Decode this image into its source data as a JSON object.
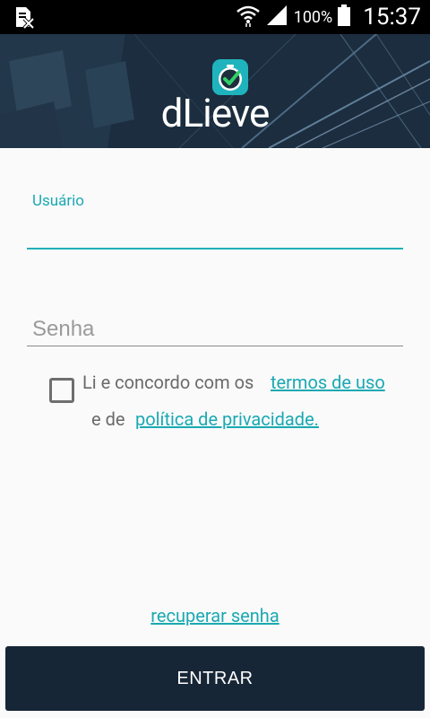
{
  "status_bar": {
    "battery": "100%",
    "time": "15:37",
    "icons": [
      "sim-missing-icon",
      "wifi-icon",
      "signal-icon",
      "battery-icon"
    ]
  },
  "header": {
    "logo_text": "dLieve",
    "logo_icon": "clock-check-icon"
  },
  "form": {
    "username_label": "Usuário",
    "username_value": "",
    "password_placeholder": "Senha",
    "password_value": ""
  },
  "terms": {
    "checked": false,
    "text_part1": "Li e concordo com os",
    "terms_link": "termos de uso",
    "text_part2": "e de",
    "privacy_link": "política de privacidade."
  },
  "recover_link": "recuperar senha",
  "enter_button": "ENTRAR",
  "colors": {
    "accent": "#1aa9b3",
    "button_bg": "#172636",
    "background": "#fafafa"
  }
}
